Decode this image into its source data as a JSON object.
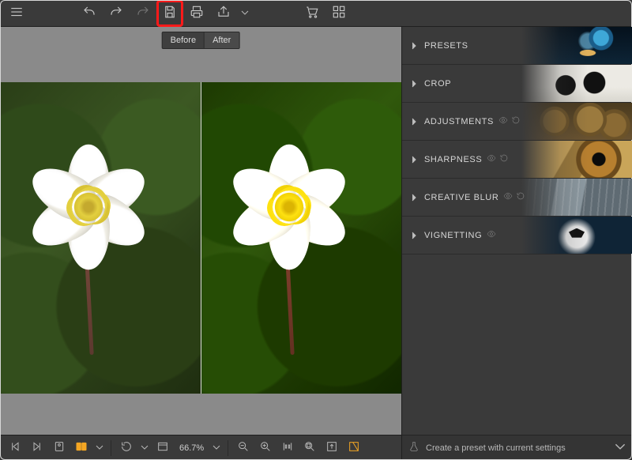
{
  "toolbar": {
    "icons": {
      "menu": "menu-icon",
      "undo": "undo-icon",
      "redo": "redo-icon",
      "redo2": "redo-forward-icon",
      "save": "save-icon",
      "print": "print-icon",
      "share": "share-icon",
      "cart": "cart-icon",
      "batch": "batch-grid-icon"
    },
    "highlighted": "save"
  },
  "compare": {
    "before": "Before",
    "after": "After"
  },
  "panels": [
    {
      "id": "presets",
      "label": "PRESETS",
      "actions": []
    },
    {
      "id": "crop",
      "label": "CROP",
      "actions": []
    },
    {
      "id": "adjustments",
      "label": "ADJUSTMENTS",
      "actions": [
        "visibility",
        "reset"
      ]
    },
    {
      "id": "sharpness",
      "label": "SHARPNESS",
      "actions": [
        "visibility",
        "reset"
      ]
    },
    {
      "id": "creativeblur",
      "label": "CREATIVE BLUR",
      "actions": [
        "visibility",
        "reset"
      ]
    },
    {
      "id": "vignetting",
      "label": "VIGNETTING",
      "actions": [
        "visibility"
      ]
    }
  ],
  "preset_create_label": "Create a preset with current settings",
  "bottom": {
    "zoom_readout": "66.7%",
    "icons": {
      "first": "first-image-icon",
      "next": "next-image-icon",
      "single": "single-view-icon",
      "compare": "compare-view-icon",
      "rotate": "rotate-icon",
      "fit": "fit-screen-icon",
      "zoom_out": "zoom-out-icon",
      "zoom_in": "zoom-in-icon",
      "actual": "actual-size-icon",
      "nav": "navigator-icon",
      "export": "export-icon",
      "save_result": "save-result-icon"
    }
  },
  "colors": {
    "accent": "#f4a623",
    "highlight": "#ff1a1a"
  }
}
